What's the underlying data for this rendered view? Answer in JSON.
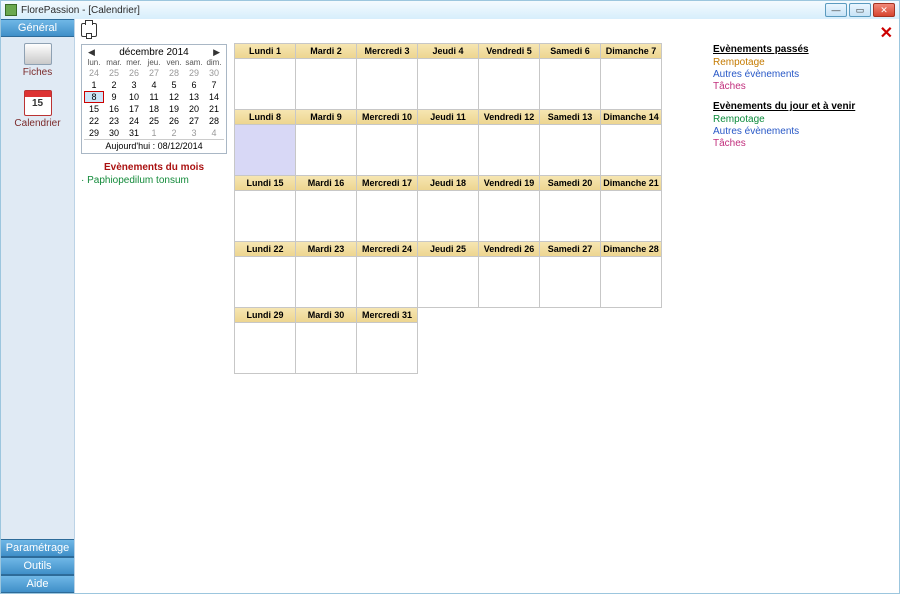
{
  "title": "FlorePassion - [Calendrier]",
  "sidebar": {
    "sections": {
      "general": "Général",
      "parametrage": "Paramétrage",
      "outils": "Outils",
      "aide": "Aide"
    },
    "fiches": "Fiches",
    "calendrier": "Calendrier",
    "cal_day": "15"
  },
  "mini_cal": {
    "title": "décembre 2014",
    "dow": [
      "lun.",
      "mar.",
      "mer.",
      "jeu.",
      "ven.",
      "sam.",
      "dim."
    ],
    "days": [
      {
        "n": "24",
        "dim": true
      },
      {
        "n": "25",
        "dim": true
      },
      {
        "n": "26",
        "dim": true
      },
      {
        "n": "27",
        "dim": true
      },
      {
        "n": "28",
        "dim": true
      },
      {
        "n": "29",
        "dim": true
      },
      {
        "n": "30",
        "dim": true
      },
      {
        "n": "1"
      },
      {
        "n": "2"
      },
      {
        "n": "3"
      },
      {
        "n": "4"
      },
      {
        "n": "5"
      },
      {
        "n": "6"
      },
      {
        "n": "7"
      },
      {
        "n": "8",
        "today": true
      },
      {
        "n": "9"
      },
      {
        "n": "10"
      },
      {
        "n": "11"
      },
      {
        "n": "12"
      },
      {
        "n": "13"
      },
      {
        "n": "14"
      },
      {
        "n": "15"
      },
      {
        "n": "16"
      },
      {
        "n": "17"
      },
      {
        "n": "18"
      },
      {
        "n": "19"
      },
      {
        "n": "20"
      },
      {
        "n": "21"
      },
      {
        "n": "22"
      },
      {
        "n": "23"
      },
      {
        "n": "24"
      },
      {
        "n": "25"
      },
      {
        "n": "26"
      },
      {
        "n": "27"
      },
      {
        "n": "28"
      },
      {
        "n": "29"
      },
      {
        "n": "30"
      },
      {
        "n": "31"
      },
      {
        "n": "1",
        "dim": true
      },
      {
        "n": "2",
        "dim": true
      },
      {
        "n": "3",
        "dim": true
      },
      {
        "n": "4",
        "dim": true
      }
    ],
    "today_label": "Aujourd'hui : 08/12/2014"
  },
  "month_events": {
    "title": "Evènements du mois",
    "items": [
      "Paphiopedilum tonsum"
    ]
  },
  "big_cal": {
    "weeks": [
      [
        "Lundi 1",
        "Mardi 2",
        "Mercredi 3",
        "Jeudi 4",
        "Vendredi 5",
        "Samedi 6",
        "Dimanche 7"
      ],
      [
        "Lundi 8",
        "Mardi 9",
        "Mercredi 10",
        "Jeudi 11",
        "Vendredi 12",
        "Samedi 13",
        "Dimanche 14"
      ],
      [
        "Lundi 15",
        "Mardi 16",
        "Mercredi 17",
        "Jeudi 18",
        "Vendredi 19",
        "Samedi 20",
        "Dimanche 21"
      ],
      [
        "Lundi 22",
        "Mardi 23",
        "Mercredi 24",
        "Jeudi 25",
        "Vendredi 26",
        "Samedi 27",
        "Dimanche 28"
      ],
      [
        "Lundi 29",
        "Mardi 30",
        "Mercredi 31"
      ]
    ],
    "today_index": [
      1,
      0
    ]
  },
  "legend": {
    "past_title": "Evènements passés",
    "future_title": "Evènements du jour et à venir",
    "rempotage": "Rempotage",
    "autres": "Autres évènements",
    "taches": "Tâches"
  }
}
